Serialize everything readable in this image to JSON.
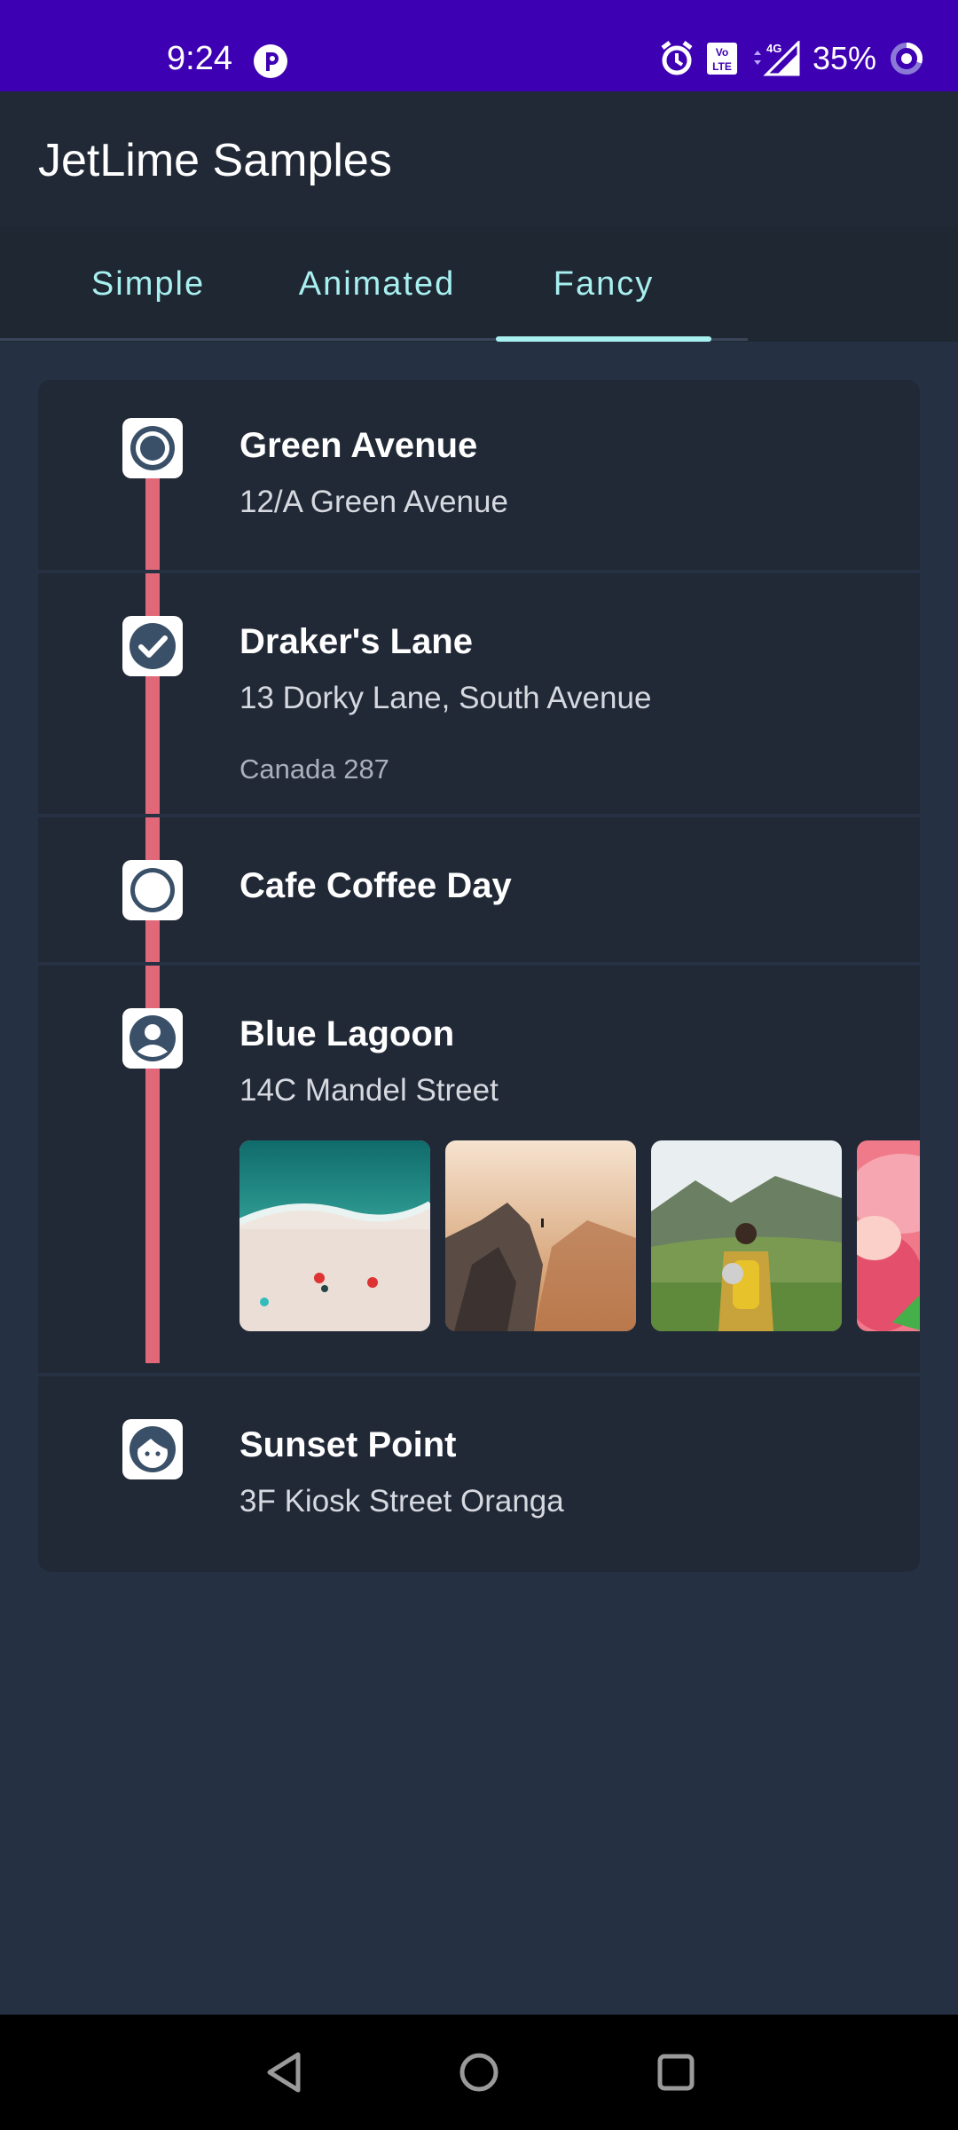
{
  "status_bar": {
    "time": "9:24",
    "battery": "35%",
    "icons": [
      "app-notification-icon",
      "alarm-icon",
      "volte-icon",
      "signal-4g-icon",
      "battery-ring-icon"
    ]
  },
  "app_bar": {
    "title": "JetLime Samples"
  },
  "tabs": [
    {
      "label": "Simple",
      "selected": false
    },
    {
      "label": "Animated",
      "selected": false
    },
    {
      "label": "Fancy",
      "selected": true
    }
  ],
  "colors": {
    "accent": "#a8f0f0",
    "timeline": "#e06878",
    "status_bar": "#3e00b3",
    "background": "#253142",
    "card": "#212836"
  },
  "timeline": [
    {
      "title": "Green Avenue",
      "subtitle": "12/A Green Avenue",
      "icon": "radio-selected-icon"
    },
    {
      "title": "Draker's Lane",
      "subtitle": "13 Dorky Lane, South Avenue",
      "extra": "Canada 287",
      "icon": "check-circle-icon"
    },
    {
      "title": "Cafe Coffee Day",
      "icon": "circle-outline-icon"
    },
    {
      "title": "Blue Lagoon",
      "subtitle": "14C Mandel Street",
      "icon": "account-circle-icon",
      "photos": [
        "beach-aerial-photo",
        "canyon-cliff-photo",
        "hiker-valley-photo",
        "pink-flower-photo"
      ]
    },
    {
      "title": "Sunset Point",
      "subtitle": "3F Kiosk Street Oranga",
      "icon": "face-icon"
    }
  ],
  "nav_bar": [
    "back-icon",
    "home-icon",
    "recents-icon"
  ]
}
